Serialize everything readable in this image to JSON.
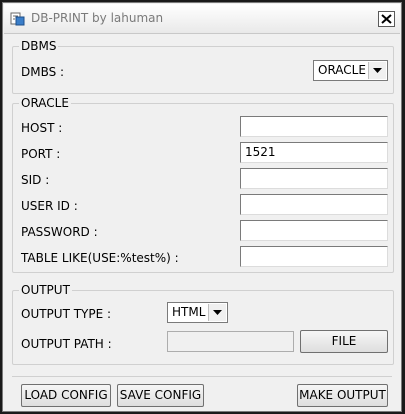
{
  "window": {
    "title": "DB-PRINT by lahuman"
  },
  "dbms": {
    "legend": "DBMS",
    "label": "DMBS :",
    "selected": "ORACLE"
  },
  "oracle": {
    "legend": "ORACLE",
    "host_label": "HOST :",
    "host_value": "",
    "port_label": "PORT :",
    "port_value": "1521",
    "sid_label": "SID :",
    "sid_value": "",
    "user_label": "USER ID :",
    "user_value": "",
    "password_label": "PASSWORD :",
    "password_value": "",
    "table_label": "TABLE LIKE(USE:%test%) :",
    "table_value": ""
  },
  "output": {
    "legend": "OUTPUT",
    "type_label": "OUTPUT TYPE :",
    "type_selected": "HTML",
    "path_label": "OUTPUT PATH :",
    "path_value": "",
    "file_button": "FILE"
  },
  "actions": {
    "load_config": "LOAD CONFIG",
    "save_config": "SAVE CONFIG",
    "make_output": "MAKE OUTPUT"
  },
  "icons": {
    "app": "app-icon",
    "close": "close-icon",
    "dropdown": "chevron-down-icon"
  }
}
